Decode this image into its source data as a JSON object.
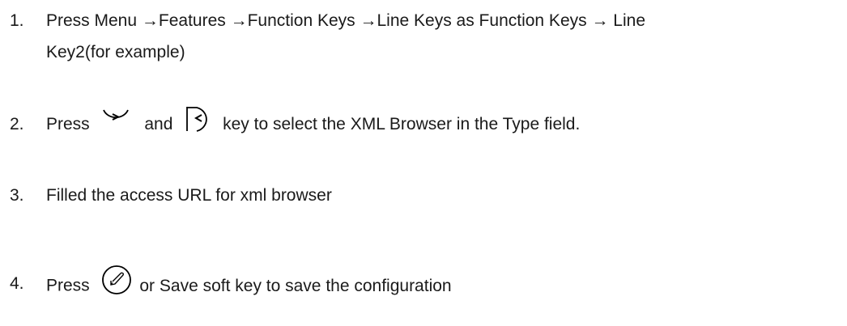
{
  "steps": [
    {
      "number": "1.",
      "line1": "Press Menu →Features →Function Keys →Line Keys as Function Keys → Line",
      "line2": "Key2(for example)"
    },
    {
      "number": "2.",
      "prefix": "Press",
      "right_key_icon": "right-arrow-key-icon",
      "middle": "and",
      "left_key_icon": "left-arrow-key-icon",
      "suffix": "key to select the XML Browser in the Type  field."
    },
    {
      "number": "3.",
      "text": "Filled the access URL for xml browser"
    },
    {
      "number": "4.",
      "prefix": "Press",
      "ok_key_icon": "ok-checkmark-key-icon",
      "suffix": "or Save soft key to save the  configuration"
    }
  ]
}
